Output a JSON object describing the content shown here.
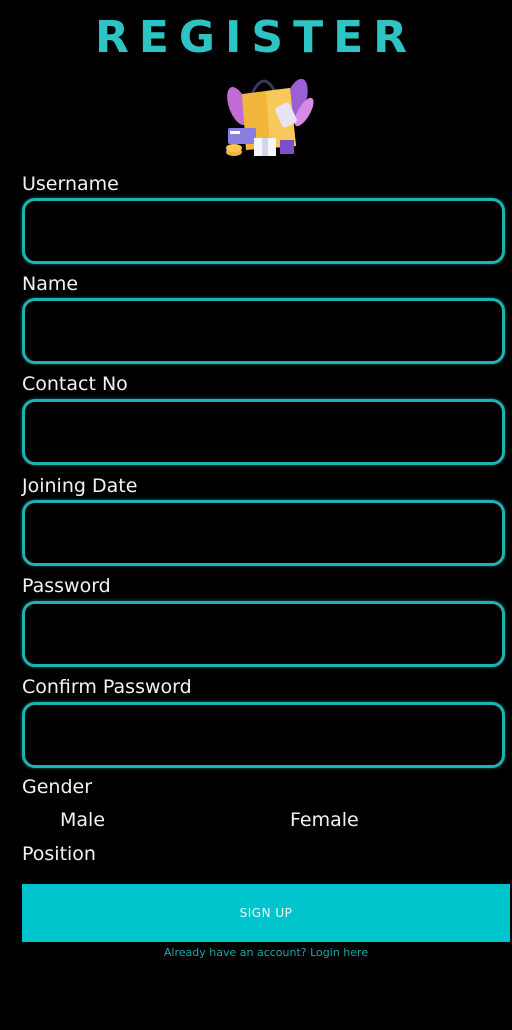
{
  "header": {
    "title": "REGISTER",
    "logo_icon": "shopping-bag-logo-icon"
  },
  "form": {
    "fields": {
      "username": {
        "label": "Username",
        "value": ""
      },
      "name": {
        "label": "Name",
        "value": ""
      },
      "contact": {
        "label": "Contact No",
        "value": ""
      },
      "joining_date": {
        "label": "Joining Date",
        "value": ""
      },
      "password": {
        "label": "Password",
        "value": ""
      },
      "confirm_password": {
        "label": "Confirm Password",
        "value": ""
      }
    },
    "gender": {
      "label": "Gender",
      "options": [
        "Male",
        "Female"
      ]
    },
    "position": {
      "label": "Position"
    },
    "signup_label": "SIGN UP",
    "login_prompt": "Already have an account?",
    "login_link": "Login here"
  },
  "colors": {
    "accent": "#1eb2b2",
    "title": "#2ec4c4",
    "button": "#00c4cc",
    "background": "#000000"
  }
}
